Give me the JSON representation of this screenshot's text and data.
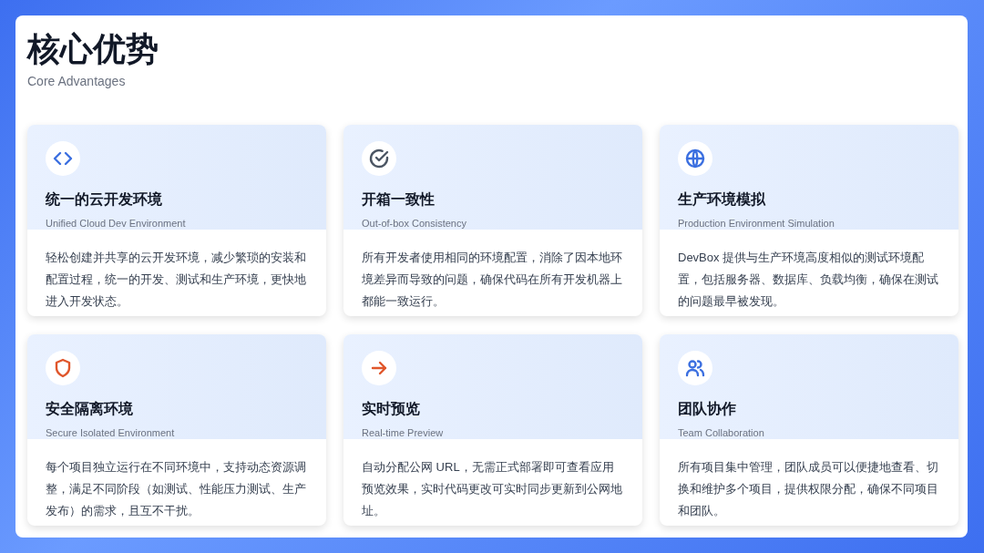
{
  "header": {
    "title": "核心优势",
    "subtitle": "Core Advantages"
  },
  "cards": [
    {
      "kind": "code",
      "color": "#3b6fe0",
      "title": "统一的云开发环境",
      "subtitle": "Unified Cloud Dev Environment",
      "description": "轻松创建并共享的云开发环境，减少繁琐的安装和配置过程，统一的开发、测试和生产环境，更快地进入开发状态。"
    },
    {
      "kind": "check",
      "color": "#4b5563",
      "title": "开箱一致性",
      "subtitle": "Out-of-box Consistency",
      "description": "所有开发者使用相同的环境配置，消除了因本地环境差异而导致的问题，确保代码在所有开发机器上都能一致运行。"
    },
    {
      "kind": "globe",
      "color": "#3b6fe0",
      "title": "生产环境模拟",
      "subtitle": "Production Environment Simulation",
      "description": "DevBox 提供与生产环境高度相似的测试环境配置，包括服务器、数据库、负载均衡，确保在测试的问题最早被发现。"
    },
    {
      "kind": "shield",
      "color": "#e0562b",
      "title": "安全隔离环境",
      "subtitle": "Secure Isolated Environment",
      "description": "每个项目独立运行在不同环境中，支持动态资源调整，满足不同阶段（如测试、性能压力测试、生产发布）的需求，且互不干扰。"
    },
    {
      "kind": "arrow",
      "color": "#e0562b",
      "title": "实时预览",
      "subtitle": "Real-time Preview",
      "description": "自动分配公网 URL，无需正式部署即可查看应用预览效果，实时代码更改可实时同步更新到公网地址。"
    },
    {
      "kind": "users",
      "color": "#3b6fe0",
      "title": "团队协作",
      "subtitle": "Team Collaboration",
      "description": "所有项目集中管理，团队成员可以便捷地查看、切换和维护多个项目，提供权限分配，确保不同项目和团队。"
    }
  ]
}
